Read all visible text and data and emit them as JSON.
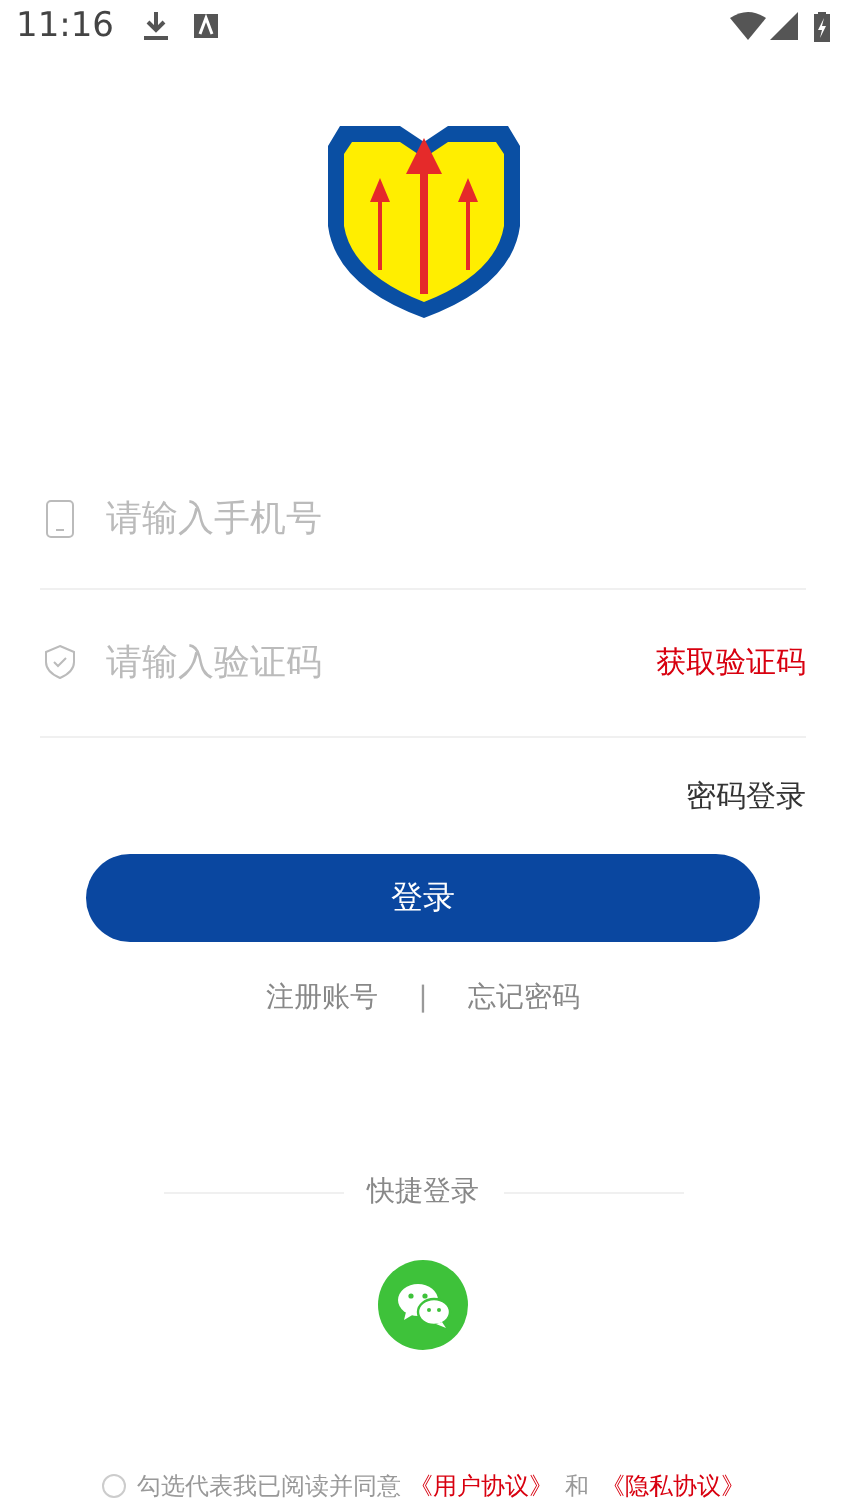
{
  "status_bar": {
    "time": "11:16"
  },
  "phone_field": {
    "placeholder": "请输入手机号"
  },
  "code_field": {
    "placeholder": "请输入验证码",
    "action": "获取验证码"
  },
  "password_login": "密码登录",
  "login_button": "登录",
  "links": [
    "注册账号",
    "忘记密码"
  ],
  "link_separator": "|",
  "quick_login": {
    "title": "快捷登录"
  },
  "agreement": {
    "checked": false,
    "text": "勾选代表我已阅读并同意",
    "user_agreement": "《用户协议》",
    "and": "和",
    "privacy_agreement": "《隐私协议》"
  }
}
